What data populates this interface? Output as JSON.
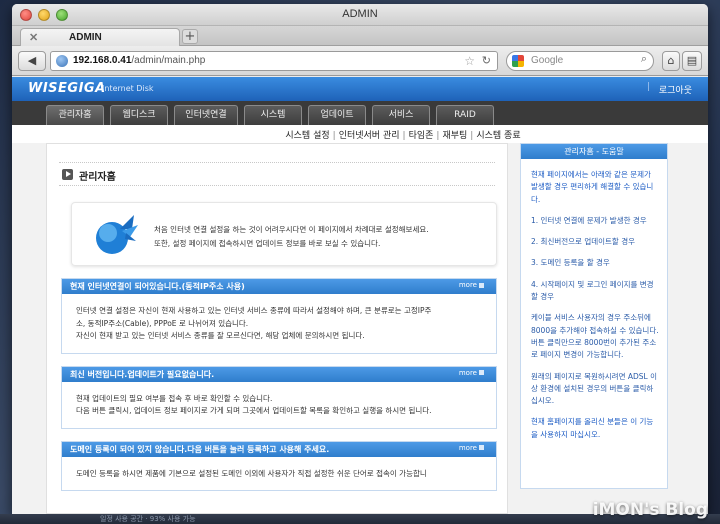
{
  "window": {
    "title": "ADMIN"
  },
  "browser": {
    "tab_label": "ADMIN",
    "url_host": "192.168.0.41",
    "url_path": "/admin/main.php",
    "search_engine": "Google",
    "search_placeholder": "Google"
  },
  "brand": {
    "logo": "WISEGIGA",
    "subtitle": "Internet Disk",
    "logout": "로그아웃"
  },
  "menu": {
    "items": [
      {
        "label": "관리자홈"
      },
      {
        "label": "웹디스크"
      },
      {
        "label": "인터넷연결"
      },
      {
        "label": "시스템"
      },
      {
        "label": "업데이트"
      },
      {
        "label": "서비스"
      },
      {
        "label": "RAID"
      }
    ]
  },
  "submenu": {
    "items": [
      {
        "label": "시스템 설정"
      },
      {
        "label": "인터넷서버 관리"
      },
      {
        "label": "타임존"
      },
      {
        "label": "재부팅"
      },
      {
        "label": "시스템 종료"
      }
    ]
  },
  "main": {
    "section_title": "관리자홈",
    "intro_line1": "처음 인터넷 연결 설정을 하는 것이 어려우시다면 이 페이지에서 차례대로 설정해보세요.",
    "intro_line2": "또한, 설정 페이지에 접속하시면 업데이트 정보를 바로 보실 수 있습니다.",
    "more_label": "more",
    "panels": [
      {
        "title": "현재 인터넷연결이 되어있습니다.(동적IP주소 사용)",
        "lines": [
          "인터넷 연결 설정은 자신이 현재 사용하고 있는 인터넷 서비스 종류에 따라서 설정해야 하며, 큰 분류로는 고정IP주",
          "소, 동적IP주소(Cable), PPPoE 로 나뉘어져 있습니다.",
          "자신이 현재 받고 있는 인터넷 서비스 종류를 잘 모르신다면, 해당 업체에 문의하시면 됩니다."
        ]
      },
      {
        "title": "최신 버전입니다.업데이트가 필요없습니다.",
        "lines": [
          "현재 업데이트의 필요 여부를 접속 후 바로 확인할 수 있습니다.",
          "다음 버튼 클릭시, 업데이트 정보 페이지로 가게 되며 그곳에서 업데이트할 목록을 확인하고 실행을 하시면 됩니다."
        ]
      },
      {
        "title": "도메인 등록이 되어 있지 않습니다.다음 버튼을 눌러 등록하고 사용해 주세요.",
        "lines": [
          "도메인 등록을 하시면 제품에 기본으로 설정된 도메인 이외에 사용자가 직접 설정한 쉬운 단어로 접속이 가능합니"
        ]
      }
    ]
  },
  "sidebar": {
    "title": "관리자홈 - 도움말",
    "intro": "현재 페이지에서는 아래와 같은 문제가 발생할 경우 편리하게 해결할 수 있습니다.",
    "items": [
      "1. 인터넷 연결에 문제가 발생한 경우",
      "2. 최신버전으로 업데이트할 경우",
      "3. 도메인 등록을 할 경우",
      "4. 시작페이지 및 로그인 페이지를 변경할 경우",
      "케이블 서비스 사용자의 경우 주소뒤에 8000을 추가해야 접속하실 수 있습니다. 버튼 클릭만으로 8000번이 추가된 주소로 페이지 변경이 가능합니다.",
      "원래의 페이지로 복원하시려면 ADSL 이상 환경에 설치된 경우의 버튼을 클릭하십시오.",
      "현재 홈페이지를 올리신 분들은 이 기능을 사용하지 마십시오."
    ]
  },
  "dock": {
    "text": "일정 사용 공간 · 93% 사용 가능"
  },
  "watermark": "iMON's Blog"
}
